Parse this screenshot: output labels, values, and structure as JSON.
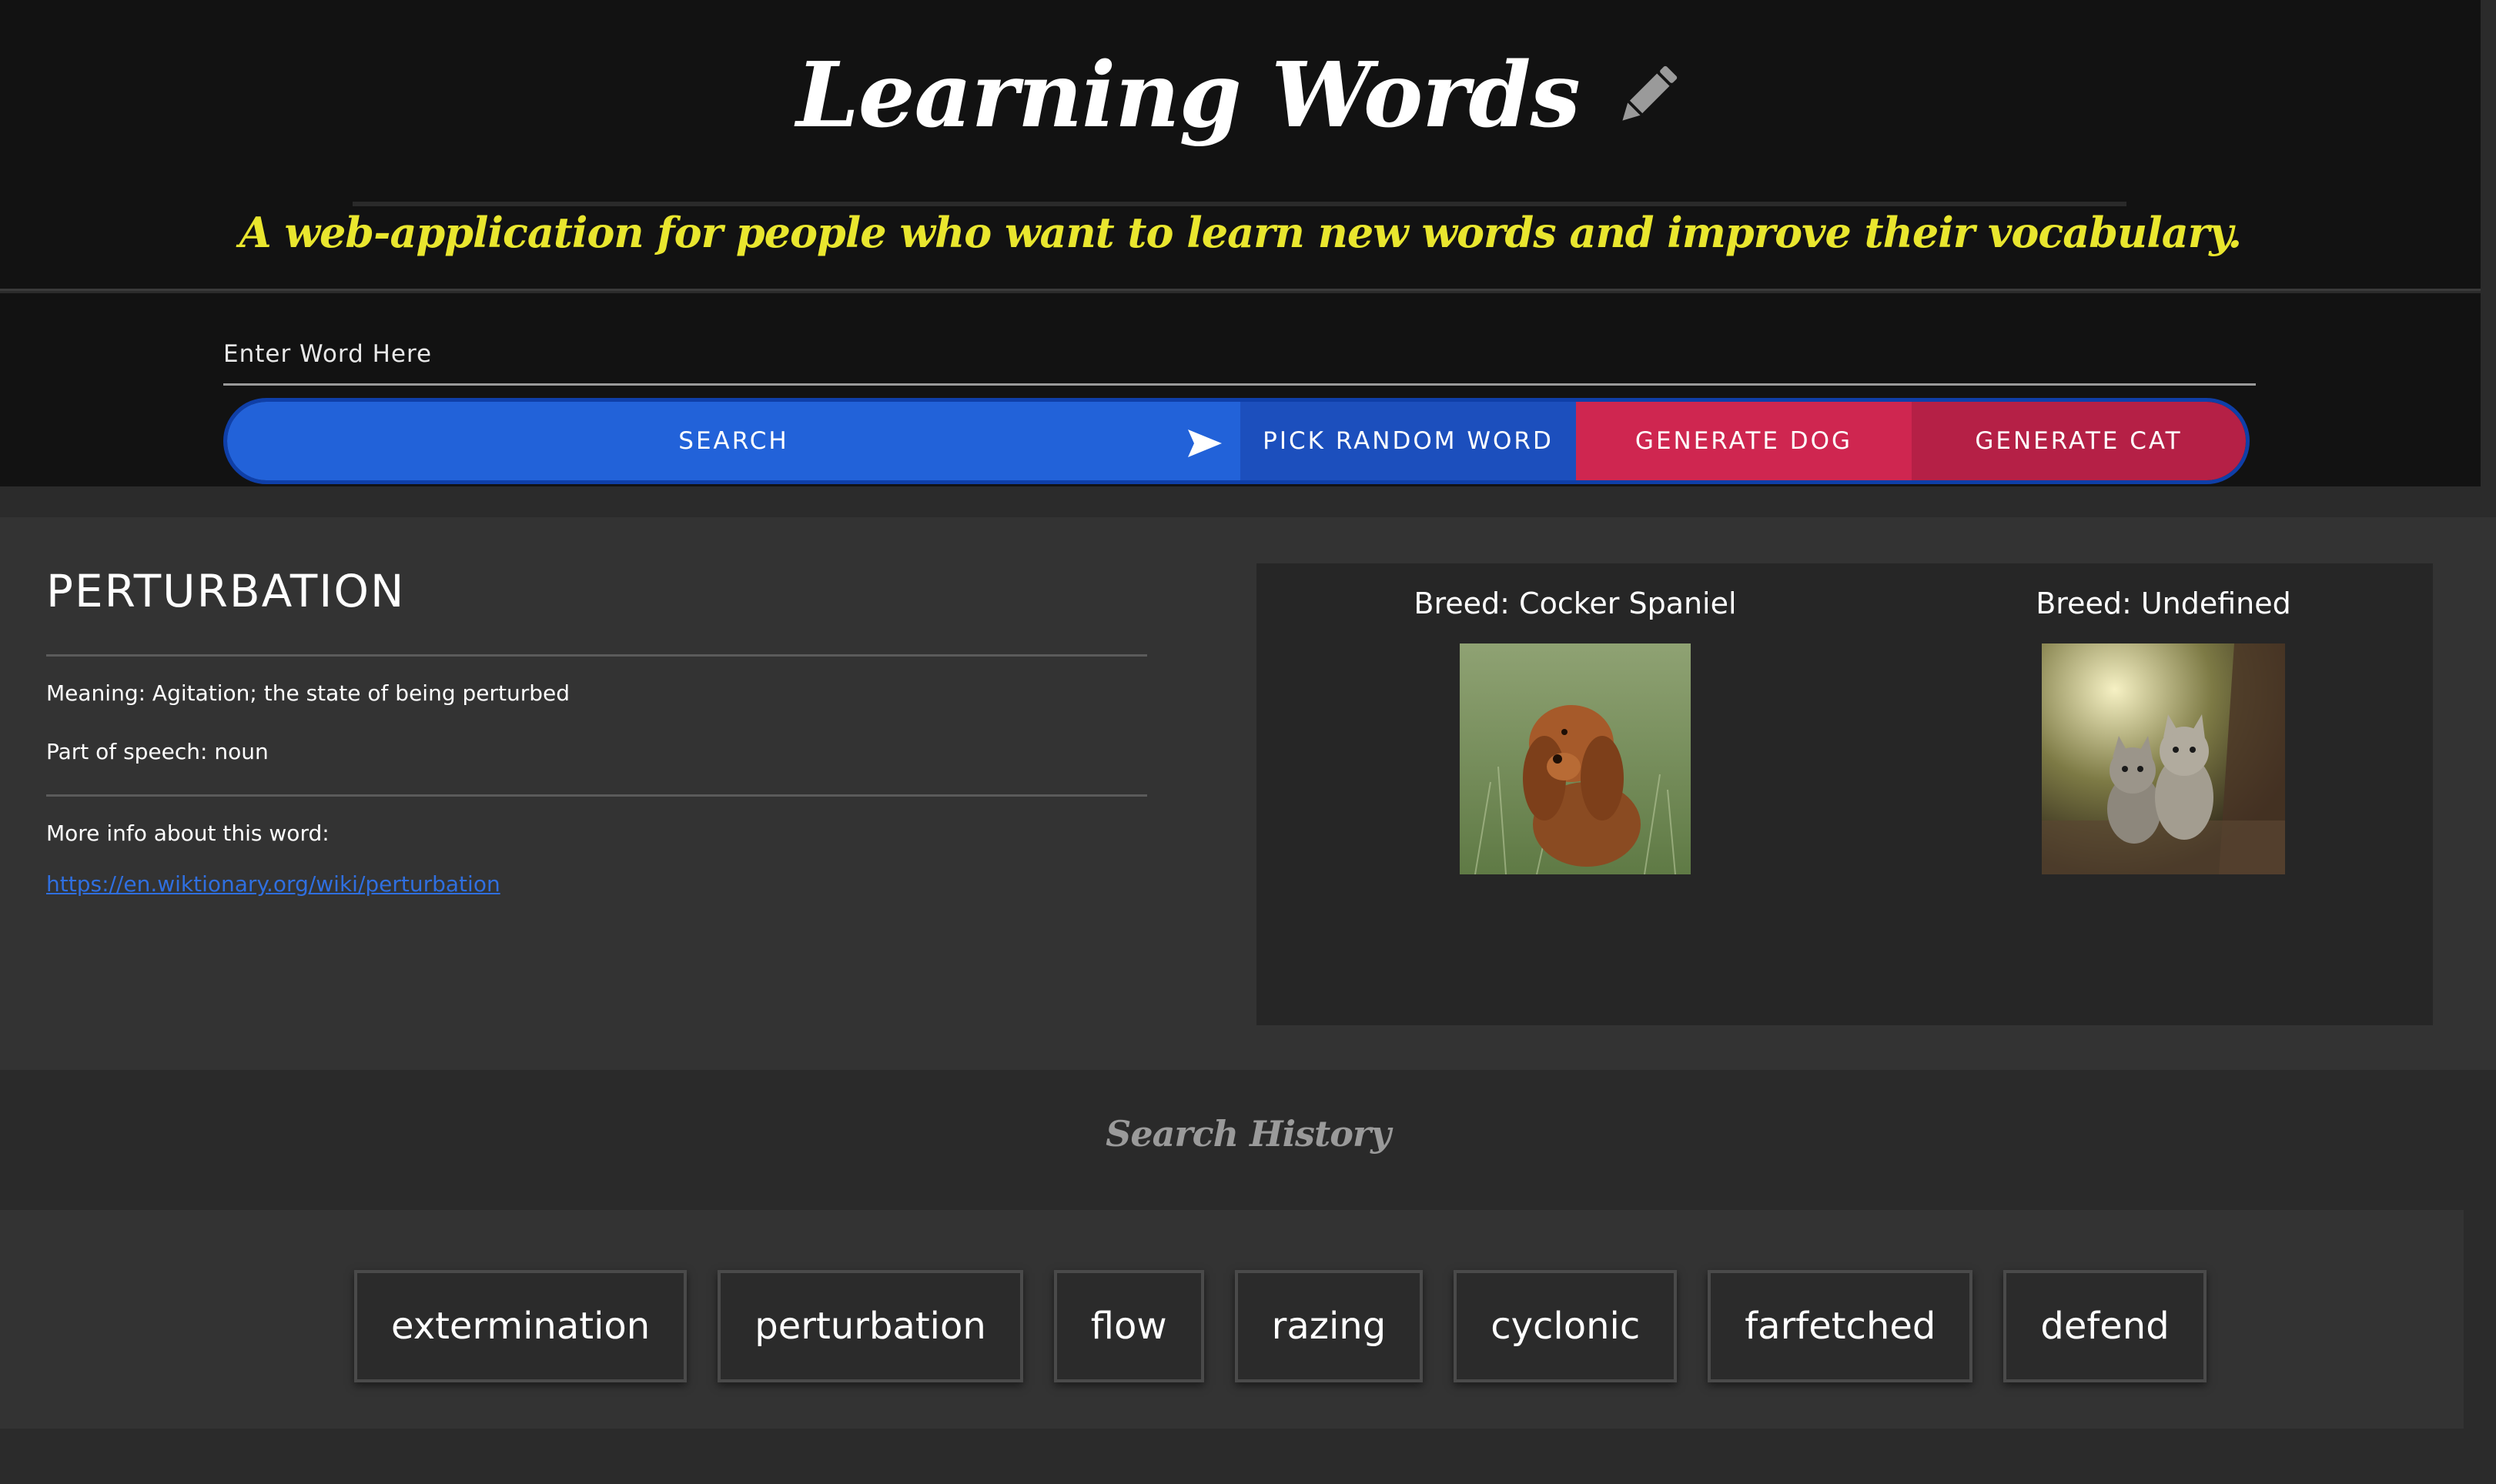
{
  "header": {
    "title": "Learning Words",
    "subtitle": "A web-application for people who want to learn new words and improve their vocabulary.",
    "pencil_icon": "pencil-icon"
  },
  "search": {
    "placeholder": "Enter Word Here",
    "value": "",
    "search_label": "SEARCH",
    "random_label": "PICK RANDOM WORD",
    "dog_label": "GENERATE DOG",
    "cat_label": "GENERATE CAT",
    "send_icon": "send-icon"
  },
  "word": {
    "heading": "PERTURBATION",
    "meaning": "Meaning: Agitation; the state of being perturbed",
    "part_of_speech": "Part of speech: noun",
    "more_info": "More info about this word:",
    "link_text": "https://en.wiktionary.org/wiki/perturbation"
  },
  "pets": {
    "dog_breed": "Breed: Cocker Spaniel",
    "cat_breed": "Breed: Undefined"
  },
  "history": {
    "title": "Search History",
    "items": [
      "extermination",
      "perturbation",
      "flow",
      "razing",
      "cyclonic",
      "farfetched",
      "defend"
    ]
  },
  "colors": {
    "header_bg": "#121212",
    "subtitle": "#e9e62e",
    "search_blue": "#2262d9",
    "random_blue": "#1c4fbd",
    "dog_red": "#cf2650",
    "cat_red": "#b52046",
    "link": "#2f6fe0"
  }
}
